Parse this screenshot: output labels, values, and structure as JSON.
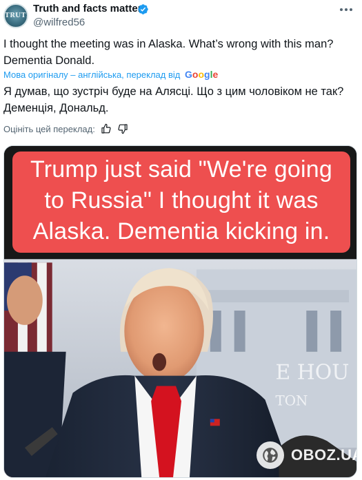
{
  "author": {
    "display_name": "Truth and facts matter.",
    "handle": "@wilfred56",
    "avatar_text": "TRUTH"
  },
  "tweet": {
    "text_line1": "I thought the meeting was in Alaska. What’s wrong with this man?",
    "text_line2": "Dementia Donald.",
    "translation_note": "Мова оригіналу – англійська, переклад від",
    "translation_provider": "Google",
    "translated_line1": "Я думав, що зустріч буде на Алясці. Що з цим чоловіком не так?",
    "translated_line2": "Деменція, Дональд.",
    "rate_prompt": "Оцініть цей переклад:"
  },
  "media": {
    "caption_line1": "Trump just said \"We're going",
    "caption_line2": "to Russia\"  I thought it was",
    "caption_line3": "Alaska. Dementia kicking in.",
    "background_text_1": "E HOU",
    "background_text_2": "TON",
    "watermark": "OBOZ.UA"
  },
  "colors": {
    "accent_blue": "#1d9bf0",
    "caption_red": "#ee4f4f",
    "secondary_text": "#536471"
  },
  "icons": [
    "verified-badge-icon",
    "more-options-icon",
    "thumbs-up-icon",
    "thumbs-down-icon",
    "globe-icon"
  ]
}
